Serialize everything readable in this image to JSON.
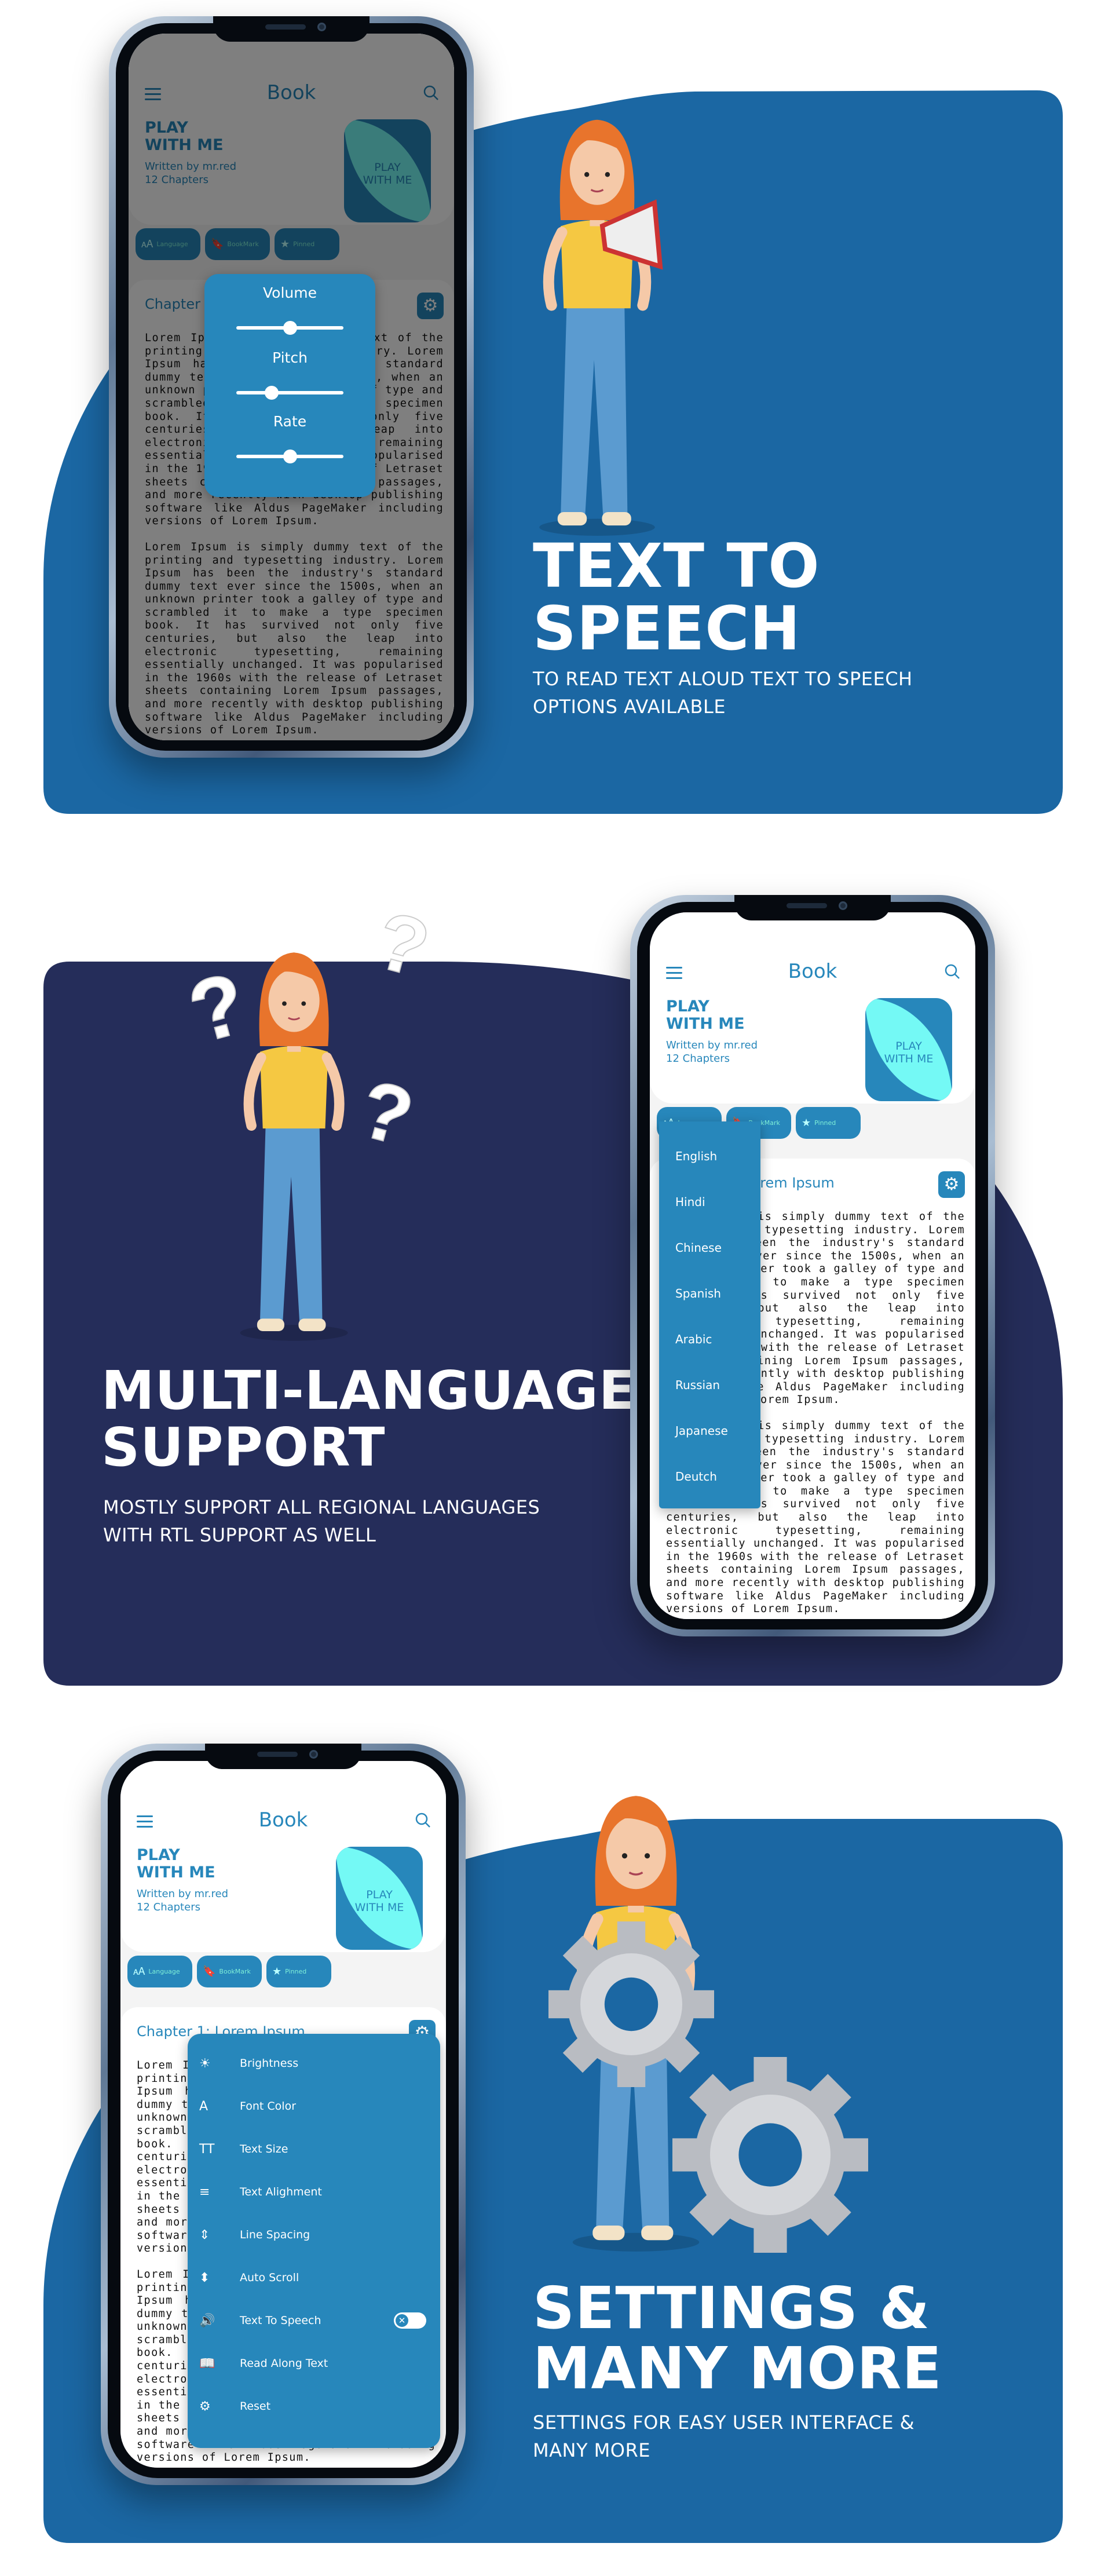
{
  "colors": {
    "section_blue": "#1b67a3",
    "section_navy": "#252d5a",
    "app_accent": "#2787bb",
    "cover_cyan": "#74f9f5"
  },
  "app": {
    "title": "Book",
    "book_title_line1": "PLAY",
    "book_title_line2": "WITH ME",
    "author": "Written by mr.red",
    "chapters": "12 Chapters",
    "cover_line1": "PLAY",
    "cover_line2": "WITH ME",
    "buttons": [
      {
        "label": "Language",
        "icon": "translate-icon"
      },
      {
        "label": "BookMark",
        "icon": "bookmark-icon"
      },
      {
        "label": "Pinned",
        "icon": "pin-icon"
      }
    ],
    "chapter_title": "Chapter 1: Lorem Ipsum",
    "paragraphs": [
      "Lorem Ipsum is simply dummy text of the printing and typesetting industry. Lorem Ipsum has been the industry's standard dummy text ever since the 1500s, when an unknown printer took a galley of type and scrambled it to make a type specimen book. It has survived not only five centuries, but also the leap into electronic typesetting, remaining essentially unchanged. It was popularised in the 1960s with the release of Letraset sheets containing Lorem Ipsum passages, and more recently with desktop publishing software like Aldus PageMaker including versions of Lorem Ipsum.",
      "Lorem Ipsum is simply dummy text of the printing and typesetting industry. Lorem Ipsum has been the industry's standard dummy text ever since the 1500s, when an unknown printer took a galley of type and scrambled it to make a type specimen book. It has survived not only five centuries, but also the leap into electronic typesetting, remaining essentially unchanged. It was popularised in the 1960s with the release of Letraset sheets containing Lorem Ipsum passages, and more recently with desktop publishing software like Aldus PageMaker including versions of Lorem Ipsum."
    ]
  },
  "tts_popup": {
    "sliders": [
      {
        "label": "Volume",
        "value": 0.5
      },
      {
        "label": "Pitch",
        "value": 0.33
      },
      {
        "label": "Rate",
        "value": 0.5
      }
    ]
  },
  "language_menu": {
    "options": [
      "English",
      "Hindi",
      "Chinese",
      "Spanish",
      "Arabic",
      "Russian",
      "Japanese",
      "Deutch"
    ]
  },
  "settings_menu": {
    "items": [
      {
        "label": "Brightness",
        "icon": "brightness-icon"
      },
      {
        "label": "Font Color",
        "icon": "font-color-icon"
      },
      {
        "label": "Text Size",
        "icon": "text-size-icon"
      },
      {
        "label": "Text Alighment",
        "icon": "text-align-icon"
      },
      {
        "label": "Line Spacing",
        "icon": "line-spacing-icon"
      },
      {
        "label": "Auto Scroll",
        "icon": "auto-scroll-icon"
      },
      {
        "label": "Text To Speech",
        "icon": "speaker-icon",
        "toggle": false
      },
      {
        "label": "Read Along Text",
        "icon": "read-along-icon"
      },
      {
        "label": "Reset",
        "icon": "gear-icon"
      }
    ]
  },
  "sections": [
    {
      "heading_line1": "TEXT TO",
      "heading_line2": "SPEECH",
      "sub_line1": "TO READ TEXT ALOUD TEXT TO SPEECH",
      "sub_line2": "OPTIONS AVAILABLE"
    },
    {
      "heading_line1": "MULTI-LANGUAGE",
      "heading_line2": "SUPPORT",
      "sub_line1": "MOSTLY SUPPORT ALL REGIONAL LANGUAGES",
      "sub_line2": "WITH RTL SUPPORT AS WELL"
    },
    {
      "heading_line1": "SETTINGS &",
      "heading_line2": "MANY MORE",
      "sub_line1": "SETTINGS FOR EASY USER INTERFACE &",
      "sub_line2": "MANY MORE"
    }
  ],
  "decor": {
    "question_mark": "?"
  }
}
